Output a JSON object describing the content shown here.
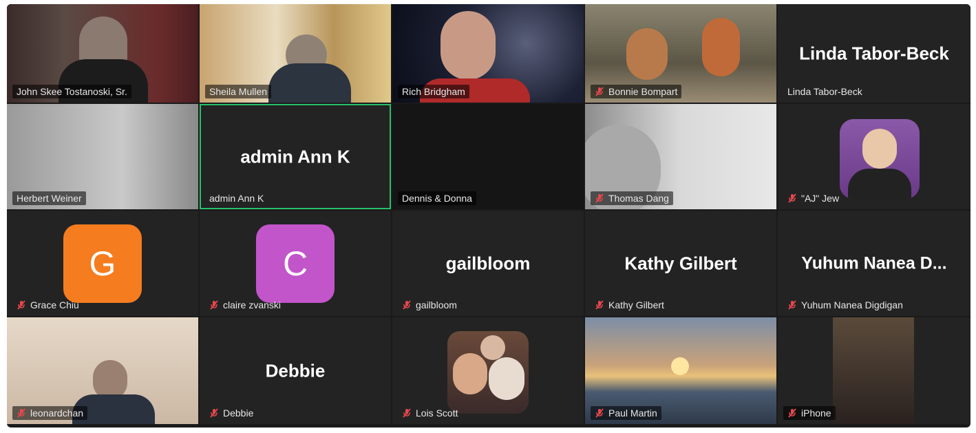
{
  "window": {
    "title": ""
  },
  "tiles": [
    {
      "name": "John Skee Tostanoski, Sr.",
      "muted": false
    },
    {
      "name": "Sheila Mullen",
      "muted": false
    },
    {
      "name": "Rich Bridgham",
      "muted": false
    },
    {
      "name": "Bonnie Bompart",
      "muted": true
    },
    {
      "name": "Linda Tabor-Beck",
      "muted": false,
      "display_name": "Linda Tabor-Beck"
    },
    {
      "name": "Herbert Weiner",
      "muted": false
    },
    {
      "name": "admin Ann K",
      "muted": false,
      "display_name": "admin Ann K",
      "active_speaker": true
    },
    {
      "name": "Dennis & Donna",
      "muted": false
    },
    {
      "name": "Thomas Dang",
      "muted": true
    },
    {
      "name": "\"AJ\" Jew",
      "muted": true
    },
    {
      "name": "Grace Chiu",
      "muted": true,
      "avatar_letter": "G",
      "avatar_color": "#f57c1f"
    },
    {
      "name": "claire zvanski",
      "muted": true,
      "avatar_letter": "C",
      "avatar_color": "#c255c9"
    },
    {
      "name": "gailbloom",
      "muted": true,
      "display_name": "gailbloom"
    },
    {
      "name": "Kathy Gilbert",
      "muted": true,
      "display_name": "Kathy Gilbert"
    },
    {
      "name": "Yuhum Nanea Digdigan",
      "muted": true,
      "display_name": "Yuhum Nanea D..."
    },
    {
      "name": "leonardchan",
      "muted": true
    },
    {
      "name": "Debbie",
      "muted": true,
      "display_name": "Debbie"
    },
    {
      "name": "Lois Scott",
      "muted": true
    },
    {
      "name": "Paul Martin",
      "muted": true
    },
    {
      "name": "iPhone",
      "muted": true
    }
  ],
  "colors": {
    "active_border": "#27c16a",
    "muted_icon": "#e5484d",
    "tile_bg": "#232323"
  }
}
